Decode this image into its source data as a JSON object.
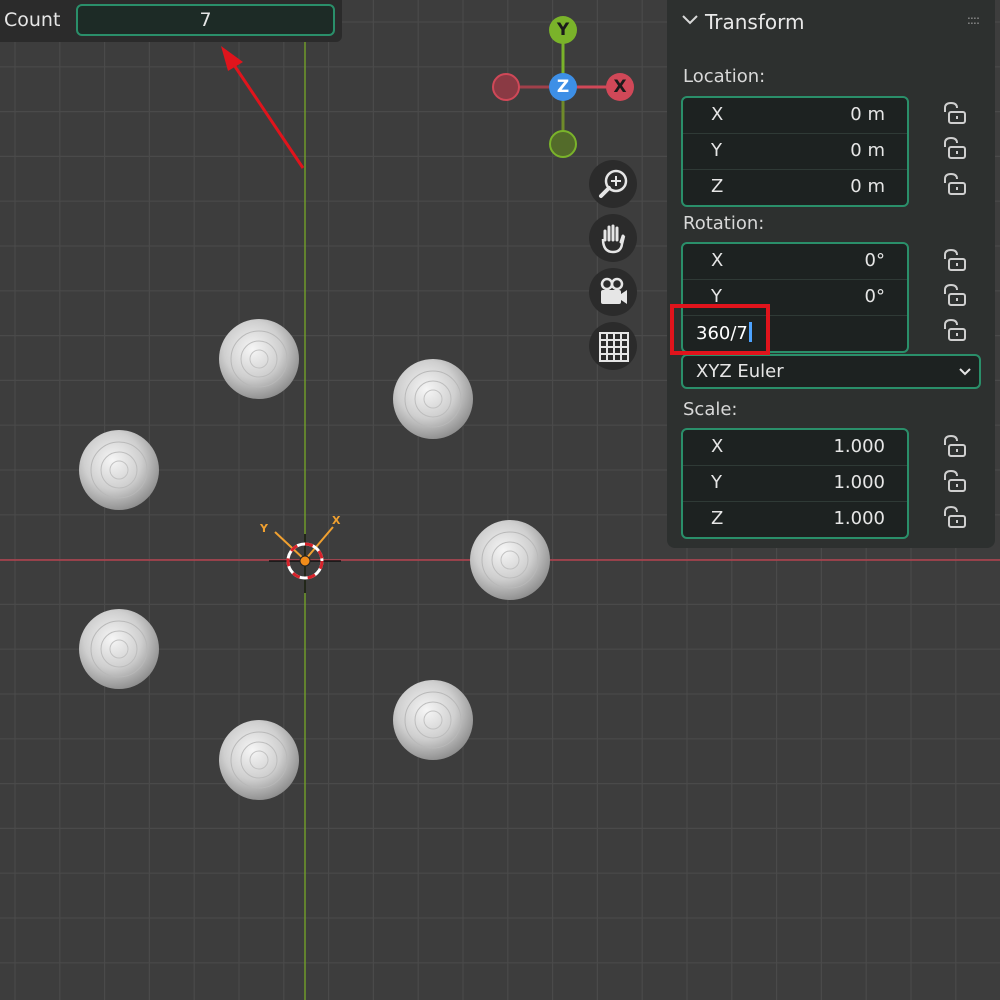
{
  "redo_panel": {
    "label": "Count",
    "value": "7"
  },
  "gizmo": {
    "y": "Y",
    "z": "Z",
    "x": "X"
  },
  "nav_icons": [
    "zoom-icon",
    "hand-pan-icon",
    "camera-icon",
    "grid-ortho-icon"
  ],
  "empty_labels": {
    "y": "Y",
    "x": "X"
  },
  "transform": {
    "title": "Transform",
    "location_label": "Location:",
    "location": [
      {
        "axis": "X",
        "value": "0 m"
      },
      {
        "axis": "Y",
        "value": "0 m"
      },
      {
        "axis": "Z",
        "value": "0 m"
      }
    ],
    "rotation_label": "Rotation:",
    "rotation": [
      {
        "axis": "X",
        "value": "0°"
      },
      {
        "axis": "Y",
        "value": "0°"
      }
    ],
    "rotation_z_editing": "360/7",
    "rotation_mode": "XYZ Euler",
    "scale_label": "Scale:",
    "scale": [
      {
        "axis": "X",
        "value": "1.000"
      },
      {
        "axis": "Y",
        "value": "1.000"
      },
      {
        "axis": "Z",
        "value": "1.000"
      }
    ]
  },
  "colors": {
    "field_border": "#2a8f6a",
    "highlight": "#e0141c",
    "x_axis": "#d04858",
    "y_axis": "#7ab32a",
    "z_axis": "#3d8fe6"
  }
}
